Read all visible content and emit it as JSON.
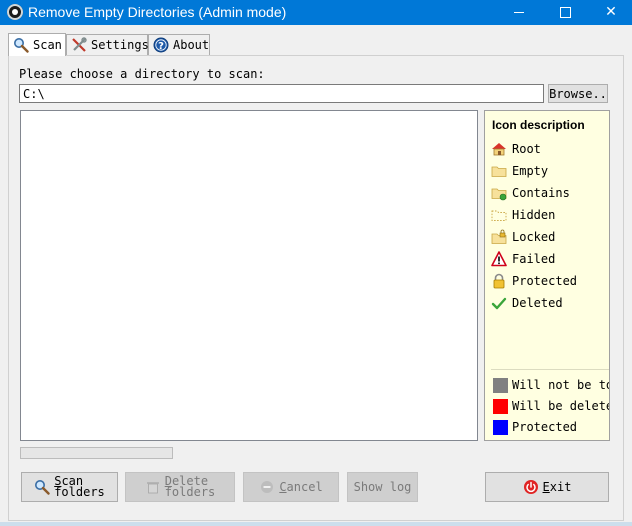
{
  "window": {
    "title": "Remove Empty Directories (Admin mode)",
    "minimize": "",
    "maximize": "",
    "close": "✕"
  },
  "tabs": [
    {
      "label": "Scan",
      "icon": "magnifier-icon"
    },
    {
      "label": "Settings",
      "icon": "tools-icon"
    },
    {
      "label": "About",
      "icon": "question-icon"
    }
  ],
  "scan": {
    "prompt": "Please choose a directory to scan:",
    "path_value": "C:\\",
    "browse_label": "Browse.."
  },
  "legend": {
    "title": "Icon description",
    "items": [
      {
        "label": "Root",
        "icon": "house-icon"
      },
      {
        "label": "Empty",
        "icon": "empty-folder-icon"
      },
      {
        "label": "Contains",
        "icon": "folder-contains-icon"
      },
      {
        "label": "Hidden",
        "icon": "hidden-folder-icon"
      },
      {
        "label": "Locked",
        "icon": "locked-folder-icon"
      },
      {
        "label": "Failed",
        "icon": "warning-icon"
      },
      {
        "label": "Protected",
        "icon": "padlock-icon"
      },
      {
        "label": "Deleted",
        "icon": "checkmark-icon"
      }
    ],
    "colors": [
      {
        "label": "Will not be touc",
        "color": "#808080"
      },
      {
        "label": "Will be deleted",
        "color": "#ff0000"
      },
      {
        "label": "Protected",
        "color": "#0000ff"
      }
    ]
  },
  "buttons": {
    "scan_line1": "Scan",
    "scan_line2": "folders",
    "delete_line1": "Delete",
    "delete_line2": "folders",
    "cancel": "Cancel",
    "show_log": "Show log",
    "exit": "Exit"
  }
}
